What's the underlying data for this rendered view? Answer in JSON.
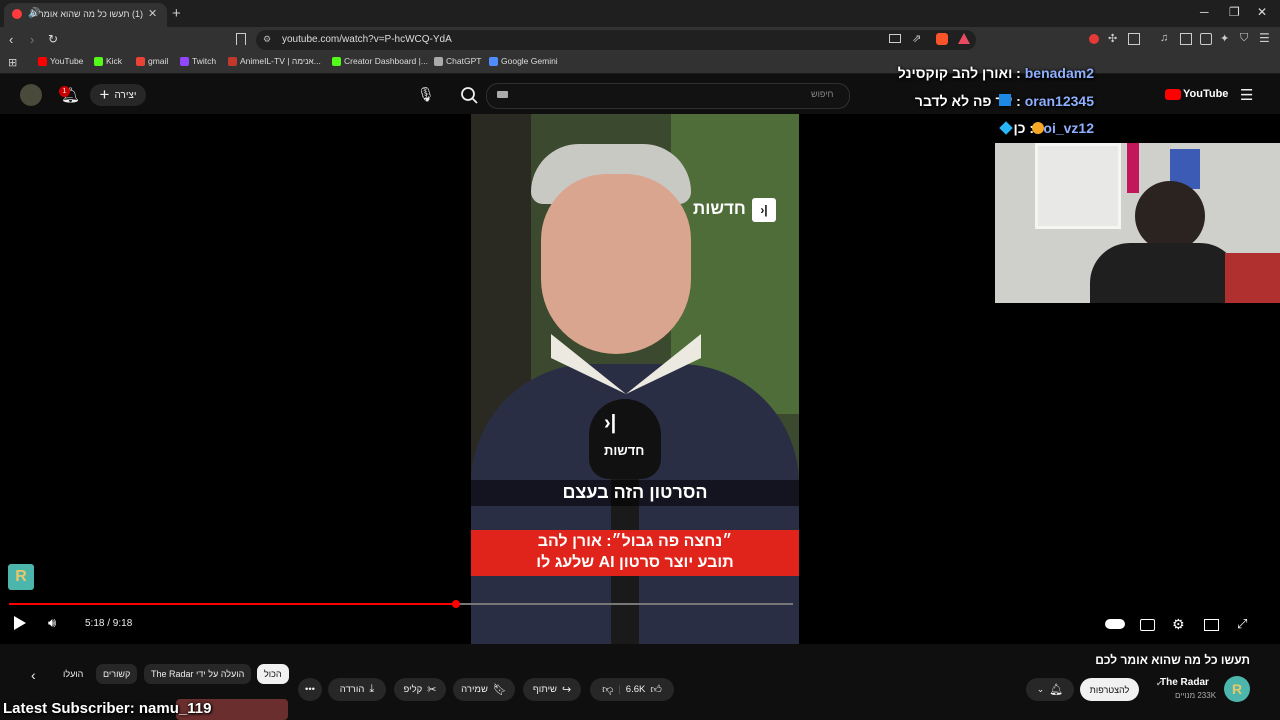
{
  "browser": {
    "tab_title": "(1) תעשו כל מה שהוא אומר ל",
    "url": "youtube.com/watch?v=P-hcWCQ-YdA",
    "bookmarks": [
      {
        "label": "YouTube",
        "color": "#ff0000"
      },
      {
        "label": "Kick",
        "color": "#53fc18"
      },
      {
        "label": "gmail",
        "color": "#ea4335"
      },
      {
        "label": "Twitch",
        "color": "#9146ff"
      },
      {
        "label": "AnimeIL-TV | אנימה...",
        "color": "#c0392b"
      },
      {
        "label": "Creator Dashboard |...",
        "color": "#53fc18"
      },
      {
        "label": "ChatGPT",
        "color": "#aaaaaa"
      },
      {
        "label": "Google Gemini",
        "color": "#4e8cff"
      }
    ]
  },
  "masthead": {
    "search_placeholder": "חיפוש",
    "create_label": "יצירה",
    "notification_count": "1",
    "logo_text": "YouTube"
  },
  "video": {
    "news_logo_text": "חדשות",
    "mic_logo_text": "חדשות",
    "caption_top": "הסרטון הזה בעצם",
    "caption_red_line1": "״נחצה פה גבול״: אורן להב",
    "caption_red_line2": "תובע יוצר סרטון AI שלעג לו",
    "current_time": "5:18",
    "duration": "9:18",
    "time_display": "5:18 / 9:18",
    "progress_fraction": 0.5699
  },
  "chat": [
    {
      "user": "benadam2",
      "message": "ואורן להב קוקסינל"
    },
    {
      "user": "oran12345",
      "message": "עד פה לא לדבר"
    },
    {
      "user": "roi_vz12",
      "message": "כן"
    }
  ],
  "below": {
    "title": "תעשו כל מה שהוא אומר לכם",
    "channel_name": "The Radar",
    "subscribers": "233K מנויים",
    "subscribe_label": "להצטרפות",
    "like_count": "6.6K",
    "share_label": "שיתוף",
    "save_label": "שמירה",
    "clip_label": "קליפ",
    "download_label": "הורדה",
    "chips": [
      "הכול",
      "הועלה על ידי The Radar",
      "קשורים",
      "הועלו"
    ]
  },
  "overlay": {
    "latest_subscriber": "Latest Subscriber: namu_119"
  },
  "colors": {
    "accent": "#ff0000",
    "background": "#0f0f0f",
    "chat_name": "#8fb0ff"
  }
}
